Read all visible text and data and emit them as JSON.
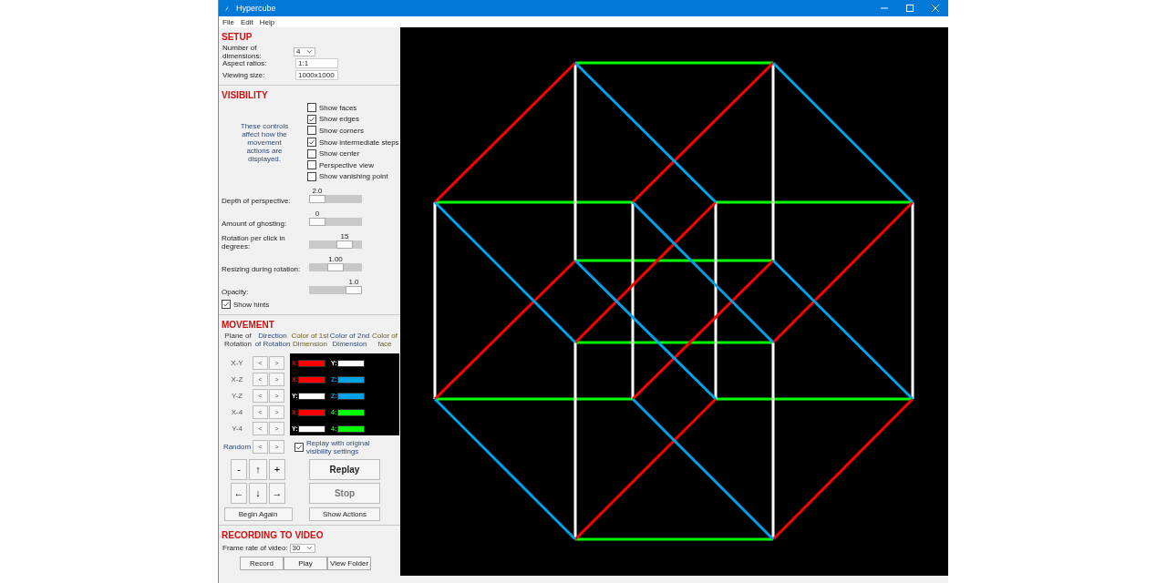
{
  "window": {
    "title": "Hypercube"
  },
  "menu": [
    {
      "label": "File"
    },
    {
      "label": "Edit"
    },
    {
      "label": "Help"
    }
  ],
  "setup": {
    "heading": "SETUP",
    "fields": [
      {
        "label": "Number of dimensions:",
        "value": "4",
        "kind": "dropdown"
      },
      {
        "label": "Aspect ratios:",
        "value": "1:1",
        "kind": "text"
      },
      {
        "label": "Viewing size:",
        "value": "1000x1000",
        "kind": "text"
      }
    ]
  },
  "visibility": {
    "heading": "VISIBILITY",
    "hint": "These controls affect how the movement actions are displayed.",
    "checkboxes": [
      {
        "label": "Show faces",
        "checked": false
      },
      {
        "label": "Show edges",
        "checked": true
      },
      {
        "label": "Show corners",
        "checked": false
      },
      {
        "label": "Show intermediate steps",
        "checked": true
      },
      {
        "label": "Show center",
        "checked": false
      },
      {
        "label": "Perspective view",
        "checked": false
      },
      {
        "label": "Show vanishing point",
        "checked": false
      }
    ],
    "sliders": [
      {
        "label": "Depth of perspective:",
        "reading": "2.0",
        "level": 0.0
      },
      {
        "label": "Amount of ghosting:",
        "reading": "0",
        "level": 0.0
      },
      {
        "label": "Rotation per click in degrees:",
        "reading": "15",
        "level": 0.75
      },
      {
        "label": "Resizing during rotation:",
        "reading": "1.00",
        "level": 0.5
      },
      {
        "label": "Opacity:",
        "reading": "1.0",
        "level": 1.0
      }
    ],
    "show_hints": {
      "label": "Show hints",
      "checked": true
    }
  },
  "movement": {
    "heading": "MOVEMENT",
    "columns": [
      "Plane of Rotation",
      "Direction of Rotation",
      "Color of 1st Dimension",
      "Color of 2nd Dimension",
      "Color of face"
    ],
    "rows": [
      {
        "plane": "X-Y",
        "back": "<",
        "forward": ">",
        "first": {
          "label": "X:",
          "color": "#ff0000"
        },
        "second": {
          "label": "Y:",
          "color": "#ffffff"
        }
      },
      {
        "plane": "X-Z",
        "back": "<",
        "forward": ">",
        "first": {
          "label": "X:",
          "color": "#ff0000"
        },
        "second": {
          "label": "Z:",
          "color": "#00a2e8"
        }
      },
      {
        "plane": "Y-Z",
        "back": "<",
        "forward": ">",
        "first": {
          "label": "Y:",
          "color": "#ffffff"
        },
        "second": {
          "label": "Z:",
          "color": "#00a2e8"
        }
      },
      {
        "plane": "X-4",
        "back": "<",
        "forward": ">",
        "first": {
          "label": "X:",
          "color": "#ff0000"
        },
        "second": {
          "label": "4:",
          "color": "#00ff00"
        }
      },
      {
        "plane": "Y-4",
        "back": "<",
        "forward": ">",
        "first": {
          "label": "Y:",
          "color": "#ffffff"
        },
        "second": {
          "label": "4:",
          "color": "#00ff00"
        }
      }
    ],
    "random": {
      "label": "Random",
      "back": "<",
      "forward": ">"
    },
    "replay_original": {
      "label": "Replay with original visibility settings",
      "checked": true
    },
    "nav_buttons": [
      {
        "label": "-"
      },
      {
        "label": "↑"
      },
      {
        "label": "+"
      },
      {
        "label": "←"
      },
      {
        "label": "↓"
      },
      {
        "label": "→"
      }
    ],
    "begin_again": "Begin Again",
    "replay": {
      "label": "Replay",
      "disabled": false
    },
    "stop": {
      "label": "Stop",
      "disabled": true
    },
    "show_actions": "Show Actions"
  },
  "recording": {
    "heading": "RECORDING TO VIDEO",
    "frame_rate_label": "Frame rate of video:",
    "frame_rate": "30",
    "buttons": [
      {
        "label": "Record"
      },
      {
        "label": "Play"
      },
      {
        "label": "View Folder"
      }
    ]
  }
}
